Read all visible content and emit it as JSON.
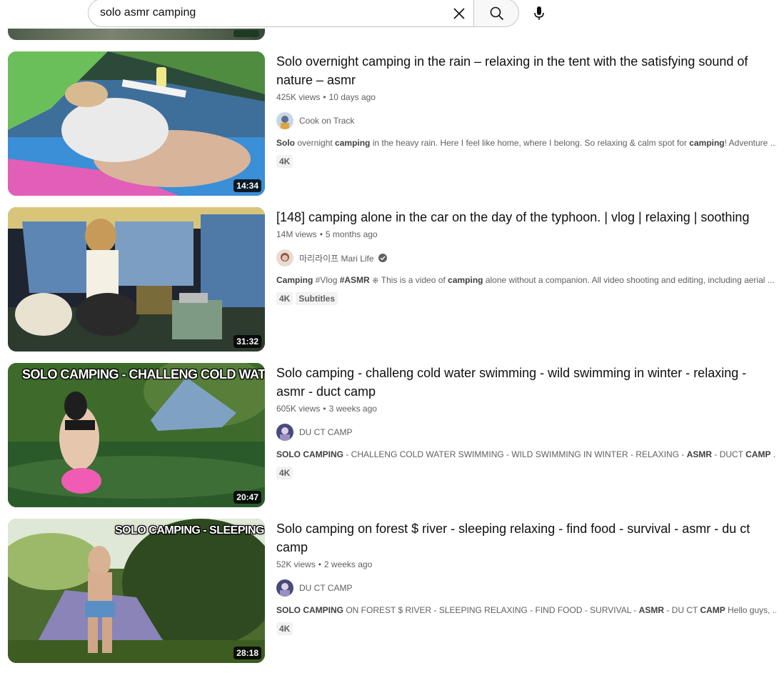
{
  "search": {
    "query": "solo asmr camping",
    "clear_icon": "close-icon",
    "search_icon": "search-icon",
    "mic_icon": "mic-icon"
  },
  "results": [
    {
      "title": "Solo overnight camping in the rain – relaxing in the tent with the satisfying sound of nature – asmr",
      "views": "425K views",
      "age": "10 days ago",
      "channel": "Cook on Track",
      "verified": false,
      "duration": "14:34",
      "description": [
        {
          "t": "Solo",
          "b": true
        },
        {
          "t": " overnight ",
          "b": false
        },
        {
          "t": "camping",
          "b": true
        },
        {
          "t": " in the heavy rain. Here I feel like home, where I belong. So relaxing & calm spot for ",
          "b": false
        },
        {
          "t": "camping",
          "b": true
        },
        {
          "t": "! Adventure ...",
          "b": false
        }
      ],
      "badges": [
        "4K"
      ],
      "thumb_overlay": ""
    },
    {
      "title": "[148] camping alone in the car on the day of the typhoon. | vlog | relaxing | soothing",
      "views": "14M views",
      "age": "5 months ago",
      "channel": "마리라이프 Mari Life",
      "verified": true,
      "duration": "31:32",
      "description": [
        {
          "t": "Camping",
          "b": true
        },
        {
          "t": " #Vlog ",
          "b": false
        },
        {
          "t": "#ASMR",
          "b": true
        },
        {
          "t": " ⎈ This is a video of ",
          "b": false
        },
        {
          "t": "camping",
          "b": true
        },
        {
          "t": " alone without a companion. All video shooting and editing, including aerial ...",
          "b": false
        }
      ],
      "badges": [
        "4K",
        "Subtitles"
      ],
      "thumb_overlay": ""
    },
    {
      "title": "Solo camping - challeng cold water swimming - wild swimming in winter - relaxing - asmr - duct camp",
      "views": "605K views",
      "age": "3 weeks ago",
      "channel": "DU CT CAMP",
      "verified": false,
      "duration": "20:47",
      "description": [
        {
          "t": "SOLO CAMPING",
          "b": true
        },
        {
          "t": " - CHALLENG COLD WATER SWIMMING - WILD SWIMMING IN WINTER - RELAXING - ",
          "b": false
        },
        {
          "t": "ASMR",
          "b": true
        },
        {
          "t": " - DUCT ",
          "b": false
        },
        {
          "t": "CAMP",
          "b": true
        },
        {
          "t": " ...",
          "b": false
        }
      ],
      "badges": [
        "4K"
      ],
      "thumb_overlay": "SOLO CAMPING - CHALLENG COLD WATER  SWIMMING"
    },
    {
      "title": "Solo camping on forest $ river - sleeping relaxing - find food - survival - asmr - du ct camp",
      "views": "52K views",
      "age": "2 weeks ago",
      "channel": "DU CT CAMP",
      "verified": false,
      "duration": "28:18",
      "description": [
        {
          "t": "SOLO CAMPING",
          "b": true
        },
        {
          "t": " ON FOREST $ RIVER - SLEEPING RELAXING - FIND FOOD - SURVIVAL - ",
          "b": false
        },
        {
          "t": "ASMR",
          "b": true
        },
        {
          "t": " - DU CT ",
          "b": false
        },
        {
          "t": "CAMP",
          "b": true
        },
        {
          "t": " Hello guys, ...",
          "b": false
        }
      ],
      "badges": [
        "4K"
      ],
      "thumb_overlay": "SOLO CAMPING  - SLEEPING  -  REALAXING"
    }
  ],
  "colors": {
    "accent_text": "#0f0f0f",
    "meta_text": "#606060",
    "badge_bg": "#f2f2f2"
  }
}
